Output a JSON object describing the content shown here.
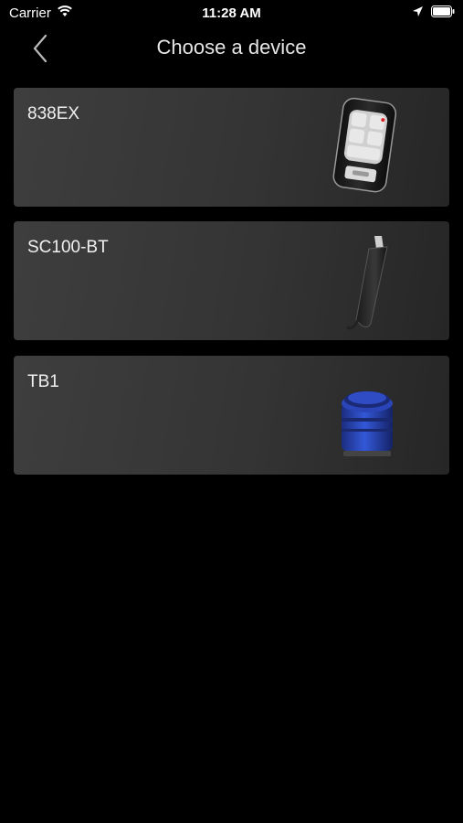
{
  "status": {
    "carrier": "Carrier",
    "time": "11:28 AM",
    "icons": [
      "wifi-icon",
      "location-arrow-icon",
      "battery-icon"
    ]
  },
  "nav": {
    "title": "Choose a device",
    "back_icon": "chevron-left-icon"
  },
  "devices": [
    {
      "label": "838EX",
      "image": "flip-key-fob"
    },
    {
      "label": "SC100-BT",
      "image": "blade-sensor"
    },
    {
      "label": "TB1",
      "image": "blue-tire-valve-cap"
    }
  ],
  "colors": {
    "background": "#000000",
    "card": "#3a3a3a",
    "accent_blue": "#2744b8"
  }
}
